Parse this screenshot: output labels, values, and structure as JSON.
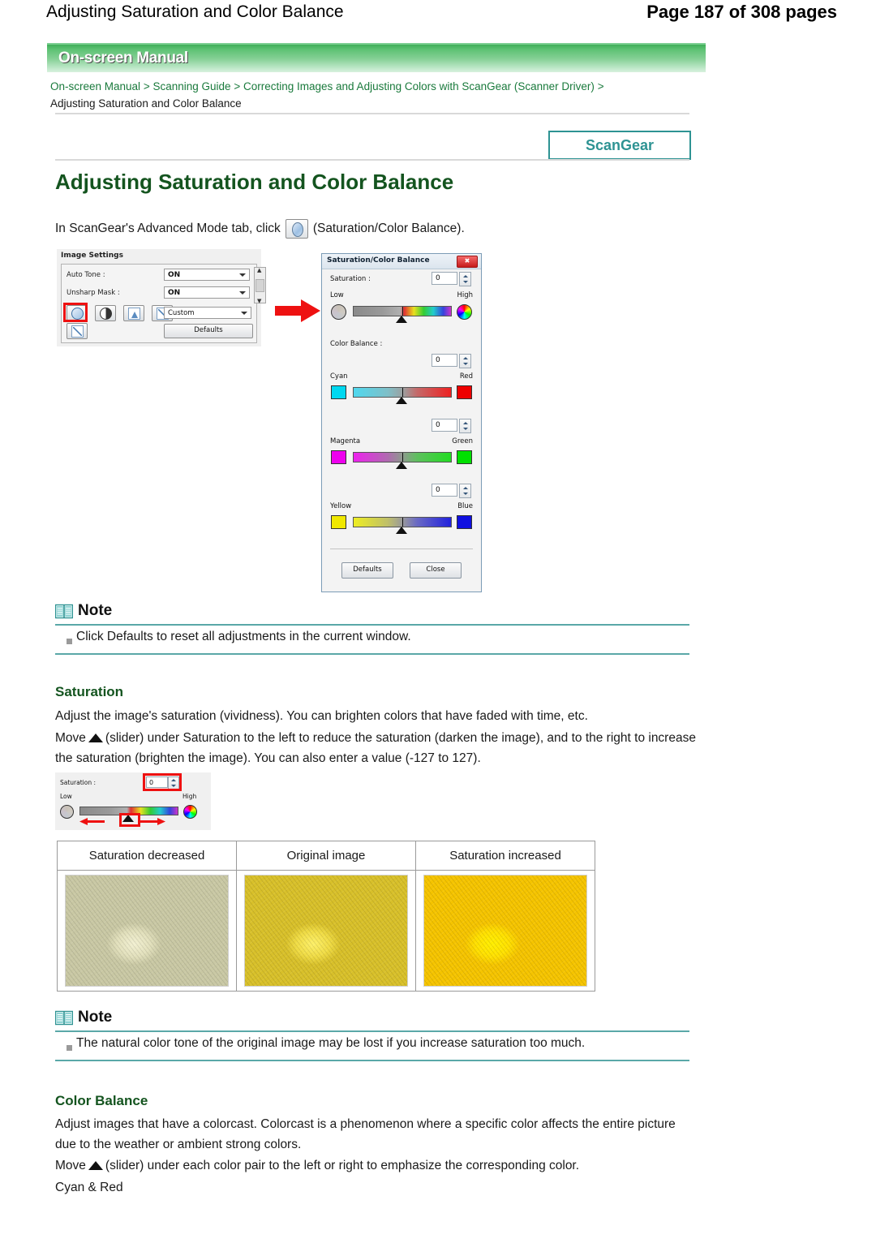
{
  "header": {
    "doc_title": "Adjusting Saturation and Color Balance",
    "page_indicator": "Page 187 of 308 pages"
  },
  "banner": {
    "label": "On-screen Manual"
  },
  "breadcrumb": {
    "items": [
      "On-screen Manual",
      "Scanning Guide",
      "Correcting Images and Adjusting Colors with ScanGear (Scanner Driver)"
    ],
    "separator": ">",
    "current": "Adjusting Saturation and Color Balance"
  },
  "badge": {
    "label": "ScanGear"
  },
  "page_title": "Adjusting Saturation and Color Balance",
  "intro": {
    "before_icon": "In ScanGear's Advanced Mode tab, click",
    "icon_name": "saturation-color-balance-icon",
    "after_icon": "(Saturation/Color Balance)."
  },
  "image_settings": {
    "title": "Image Settings",
    "rows": [
      {
        "label": "Auto Tone :",
        "value": "ON"
      },
      {
        "label": "Unsharp Mask :",
        "value": "ON"
      }
    ],
    "preset": "Custom",
    "defaults_button": "Defaults",
    "tools": [
      "saturation-color-balance-icon",
      "brightness-contrast-icon",
      "histogram-icon",
      "tone-curve-icon",
      "final-review-icon"
    ],
    "highlight_color": "#ee1111"
  },
  "dialog": {
    "title": "Saturation/Color Balance",
    "close_label": "✖",
    "saturation": {
      "label": "Saturation :",
      "value": "0",
      "low_label": "Low",
      "high_label": "High"
    },
    "color_balance": {
      "label": "Color Balance :",
      "pairs": [
        {
          "value": "0",
          "left": "Cyan",
          "right": "Red",
          "left_color": "#00d8f0",
          "right_color": "#ee0000"
        },
        {
          "value": "0",
          "left": "Magenta",
          "right": "Green",
          "left_color": "#ee00ee",
          "right_color": "#00e000"
        },
        {
          "value": "0",
          "left": "Yellow",
          "right": "Blue",
          "left_color": "#f0e800",
          "right_color": "#1010e0"
        }
      ]
    },
    "buttons": {
      "defaults": "Defaults",
      "close": "Close"
    }
  },
  "notes": [
    {
      "heading": "Note",
      "text": "Click Defaults to reset all adjustments in the current window."
    },
    {
      "heading": "Note",
      "text": "The natural color tone of the original image may be lost if you increase saturation too much."
    }
  ],
  "saturation_section": {
    "heading": "Saturation",
    "paragraph1": "Adjust the image's saturation (vividness). You can brighten colors that have faded with time, etc.",
    "paragraph2_a": "Move",
    "paragraph2_b": "(slider) under Saturation to the left to reduce the saturation (darken the image), and to the right to increase the saturation (brighten the image). You can also enter a value (-127 to 127).",
    "figure": {
      "label": "Saturation :",
      "value": "0",
      "low_label": "Low",
      "high_label": "High",
      "highlight_color": "#ee1111"
    },
    "comparison": {
      "headers": [
        "Saturation decreased",
        "Original image",
        "Saturation increased"
      ]
    }
  },
  "color_balance_section": {
    "heading": "Color Balance",
    "paragraph1": "Adjust images that have a colorcast. Colorcast is a phenomenon where a specific color affects the entire picture due to the weather or ambient strong colors.",
    "paragraph2_a": "Move",
    "paragraph2_b": "(slider) under each color pair to the left or right to emphasize the corresponding color.",
    "subheading": "Cyan & Red"
  }
}
